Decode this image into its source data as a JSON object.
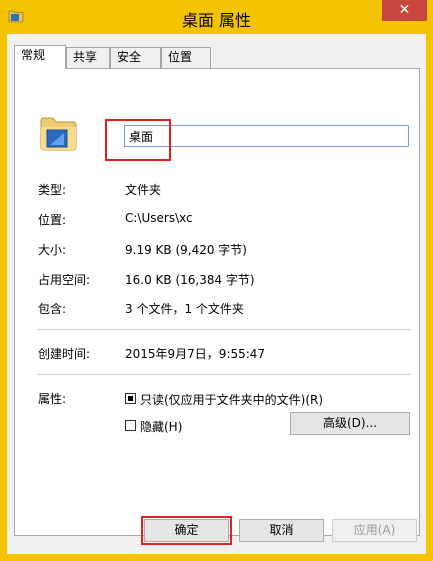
{
  "window": {
    "title": "桌面 属性",
    "close_glyph": "✕",
    "accent_color": "#f5c400",
    "close_color": "#c7463d"
  },
  "tabs": [
    {
      "label": "常规",
      "active": true
    },
    {
      "label": "共享",
      "active": false
    },
    {
      "label": "安全",
      "active": false
    },
    {
      "label": "位置",
      "active": false
    }
  ],
  "general": {
    "name_value": "桌面",
    "folder_icon": "folder-icon",
    "rows": [
      {
        "label": "类型:",
        "value": "文件夹"
      },
      {
        "label": "位置:",
        "value": "C:\\Users\\xc"
      },
      {
        "label": "大小:",
        "value": "9.19 KB (9,420 字节)"
      },
      {
        "label": "占用空间:",
        "value": "16.0 KB (16,384 字节)"
      },
      {
        "label": "包含:",
        "value": "3 个文件，1 个文件夹"
      },
      {
        "label": "创建时间:",
        "value": "2015年9月7日，9:55:47"
      }
    ],
    "attributes_label": "属性:",
    "readonly_label": "只读(仅应用于文件夹中的文件)(R)",
    "readonly_checked": true,
    "hidden_label": "隐藏(H)",
    "hidden_checked": false,
    "advanced_label": "高级(D)..."
  },
  "buttons": {
    "ok": "确定",
    "cancel": "取消",
    "apply": "应用(A)",
    "apply_enabled": false
  },
  "highlight_color": "#e02222"
}
